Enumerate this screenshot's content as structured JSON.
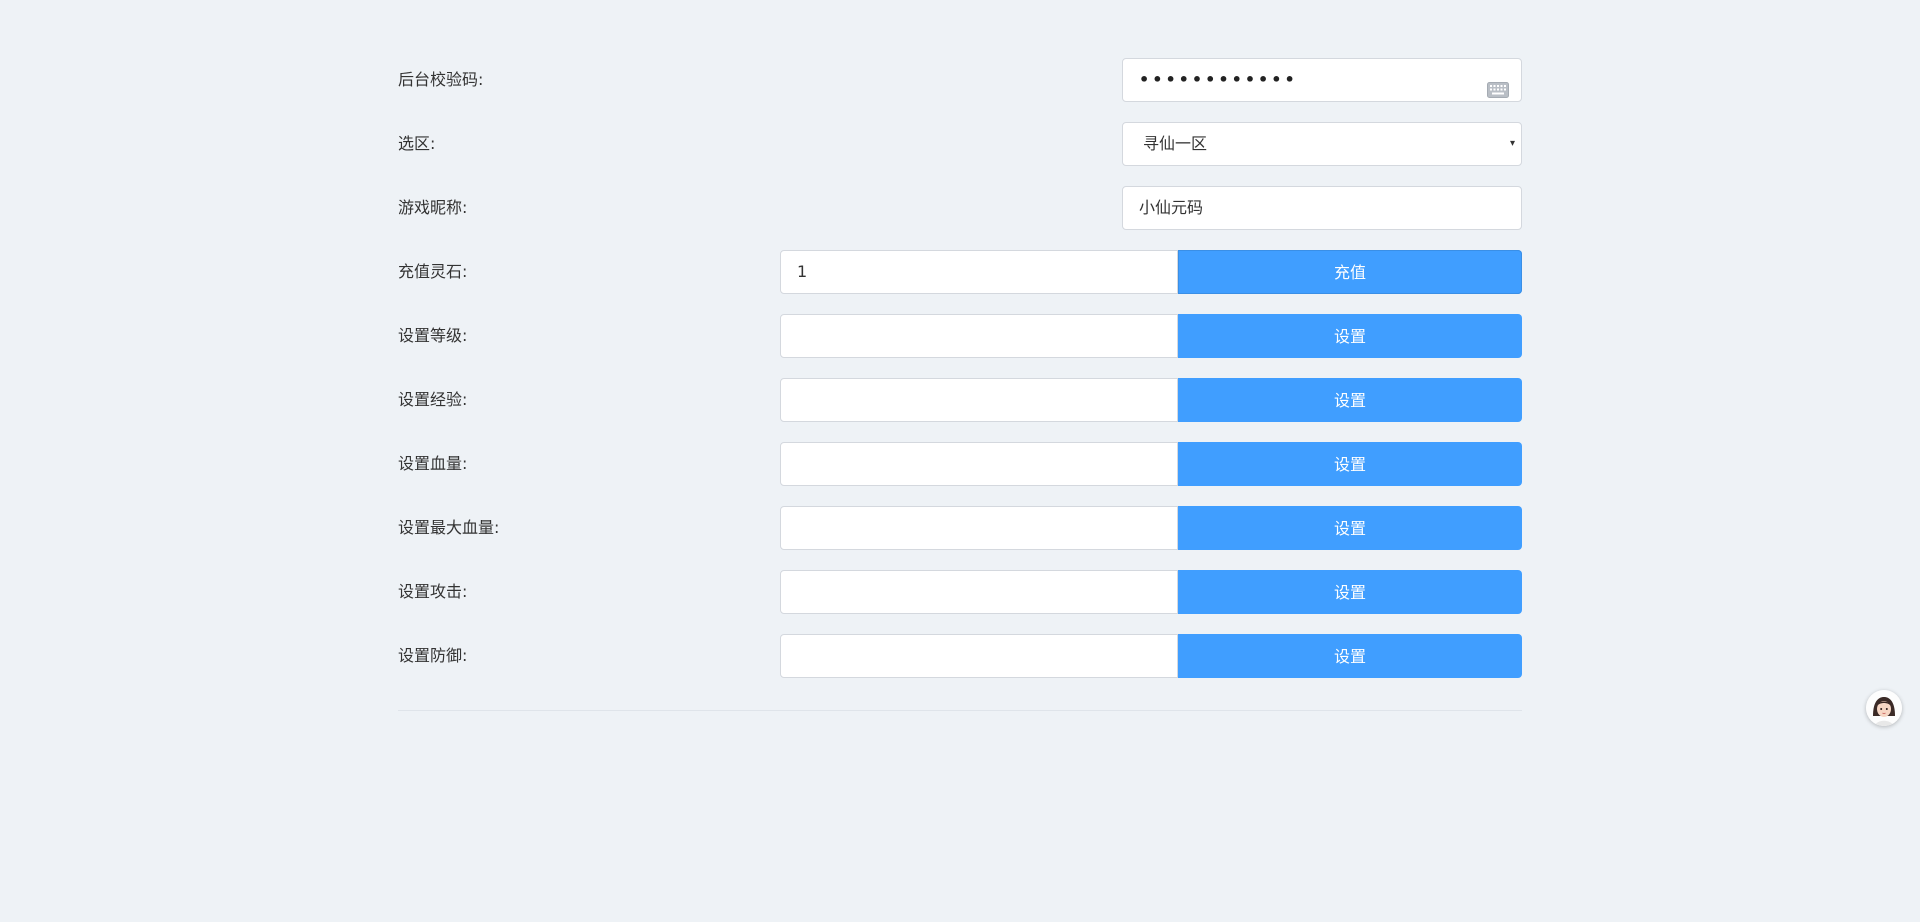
{
  "form": {
    "verify_code": {
      "label": "后台校验码:",
      "value": "••••••••••••"
    },
    "region": {
      "label": "选区:",
      "selected": "寻仙一区",
      "caret": "▾"
    },
    "nickname": {
      "label": "游戏昵称:",
      "value": "小仙元码"
    },
    "recharge": {
      "label": "充值灵石:",
      "value": "1",
      "button": "充值"
    },
    "set_rows": [
      {
        "label": "设置等级:",
        "value": "",
        "button": "设置"
      },
      {
        "label": "设置经验:",
        "value": "",
        "button": "设置"
      },
      {
        "label": "设置血量:",
        "value": "",
        "button": "设置"
      },
      {
        "label": "设置最大血量:",
        "value": "",
        "button": "设置"
      },
      {
        "label": "设置攻击:",
        "value": "",
        "button": "设置"
      },
      {
        "label": "设置防御:",
        "value": "",
        "button": "设置"
      }
    ]
  },
  "icons": {
    "keyboard": "keyboard-icon",
    "avatar": "support-avatar-icon"
  },
  "colors": {
    "accent": "#409eff",
    "background": "#eef2f6"
  }
}
